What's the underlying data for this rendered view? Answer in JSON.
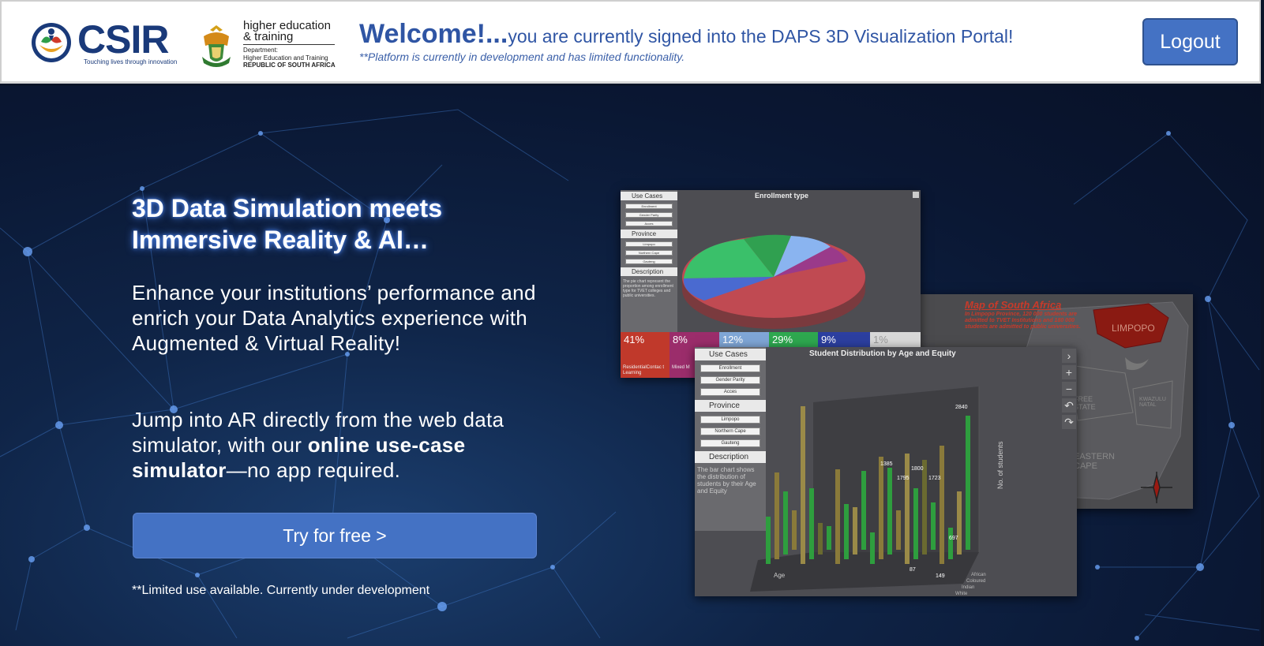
{
  "header": {
    "csir": {
      "wordmark": "CSIR",
      "tagline": "Touching lives through innovation"
    },
    "dhet": {
      "title_line1": "higher education",
      "title_line2": "& training",
      "dept": "Department:",
      "dept_name": "Higher Education and Training",
      "country": "REPUBLIC OF SOUTH AFRICA"
    },
    "welcome": "Welcome!...",
    "signed_in": "you are currently signed into the DAPS 3D Visualization Portal!",
    "note": "**Platform is currently in development and has limited functionality.",
    "logout_label": "Logout"
  },
  "hero": {
    "heading_line1": "3D Data Simulation meets",
    "heading_line2": "Immersive Reality & AI…",
    "paragraph1": "Enhance your institutions’ performance and enrich your Data Analytics experience with Augmented & Virtual Reality!",
    "paragraph2_start": "Jump into AR directly from the web data simulator, with our ",
    "paragraph2_bold": "online use-case simulator",
    "paragraph2_end": "—no app required.",
    "cta_label": "Try for free >",
    "limited_note": "**Limited use available. Currently under development"
  },
  "preview": {
    "pie": {
      "title": "Enrollment type",
      "use_cases_header": "Use Cases",
      "use_cases": [
        "Enrollment",
        "Gender Parity",
        "Acces"
      ],
      "province_header": "Province",
      "provinces": [
        "Limpopo",
        "Northern Cape",
        "Gauteng"
      ],
      "description_header": "Description",
      "description_text": "The pie chart represent the proportion among enrollment type for TVET colleges and public universities.",
      "percentages": [
        "41%",
        "8%",
        "12%",
        "29%",
        "9%",
        "1%"
      ],
      "percent_colors": [
        "#c0392b",
        "#9b2d6b",
        "#7fa6d6",
        "#2ea84f",
        "#2c3fa0",
        "#d8d8d8"
      ],
      "sub_labels": [
        "ResidentialContac t Learning",
        "Mixed M"
      ]
    },
    "map": {
      "title": "Map of South Africa",
      "text": "In Limpopo Province, 120 000 students are admitted to TVET Institutions and 180 000 students are admitted to public universities.",
      "region_limpopo": "LIMPOPO",
      "region_freestate": "FREE STATE",
      "region_kzn": "KWAZULU NATAL",
      "region_ecape": "EASTERN CAPE"
    },
    "bar": {
      "title": "Student Distribution by Age and Equity",
      "use_cases_header": "Use Cases",
      "use_cases": [
        "Enrollment",
        "Gender Parity",
        "Acces"
      ],
      "province_header": "Province",
      "provinces": [
        "Limpopo",
        "Northern Cape",
        "Gauteng"
      ],
      "description_header": "Description",
      "description_text": "The bar chart shows the distribution of students by their Age and Equity",
      "y_axis_label": "No. of students",
      "x_axis_label": "Age",
      "equity_groups": [
        "African",
        "Coloured",
        "Indian",
        "White"
      ],
      "value_labels": [
        "2840",
        "1795",
        "1800",
        "1723",
        "1385",
        "697",
        "149",
        "87"
      ]
    }
  }
}
